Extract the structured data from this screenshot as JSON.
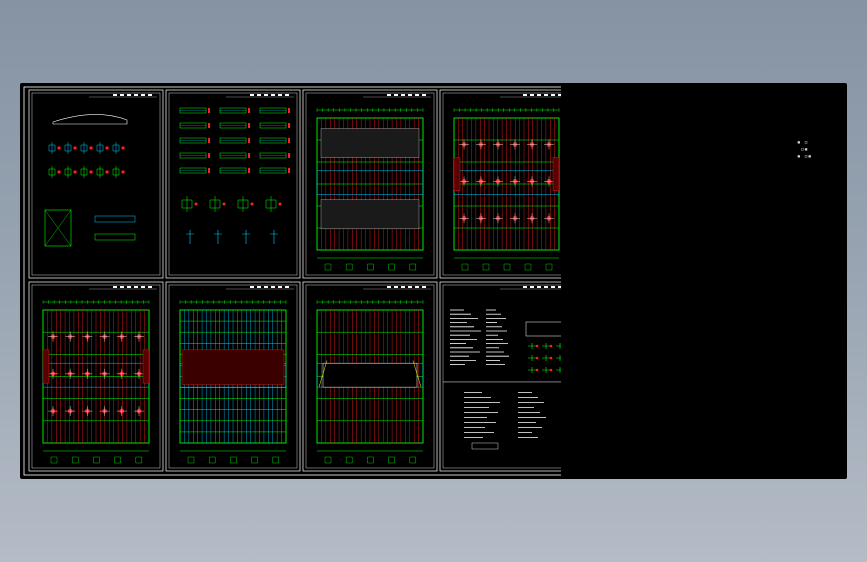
{
  "app": {
    "title": "",
    "background_colors": [
      "#8593a3",
      "#b4bcc6"
    ]
  },
  "viewer": {
    "canvas_color": "#000000",
    "frame_color": "#ffffff",
    "line_colors": {
      "grid": "#00ff00",
      "hatch": "#ff2020",
      "axis": "#00c8ff",
      "detail": "#ffffff",
      "accent": "#ffff00"
    },
    "sheets": [
      {
        "id": "sheet-1",
        "kind": "details"
      },
      {
        "id": "sheet-2",
        "kind": "section-list"
      },
      {
        "id": "sheet-3",
        "kind": "roof-plan"
      },
      {
        "id": "sheet-4",
        "kind": "plan-with-details"
      },
      {
        "id": "sheet-5",
        "kind": "plan-with-details"
      },
      {
        "id": "sheet-6",
        "kind": "framing-plan"
      },
      {
        "id": "sheet-7",
        "kind": "roof-plan-alt"
      },
      {
        "id": "sheet-8",
        "kind": "notes"
      }
    ],
    "side_mark": {
      "glyph_name": "stamp-glyph"
    }
  }
}
